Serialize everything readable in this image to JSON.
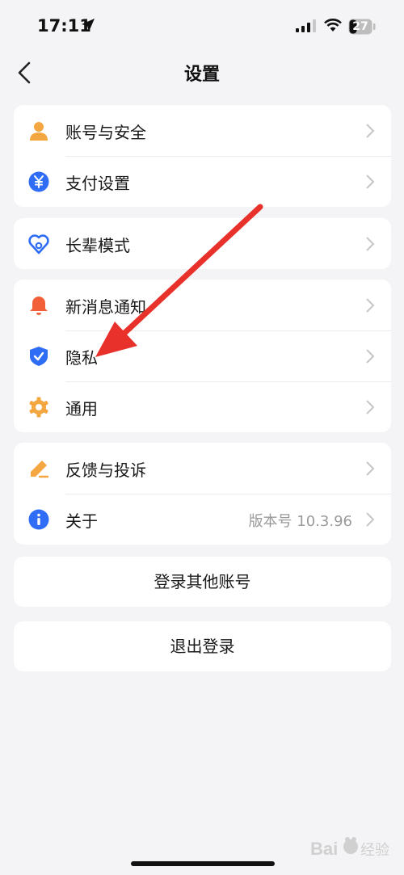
{
  "status_bar": {
    "time": "17:11",
    "battery": "27"
  },
  "nav": {
    "title": "设置"
  },
  "groups": [
    {
      "items": [
        {
          "label": "账号与安全",
          "icon": "user-icon"
        },
        {
          "label": "支付设置",
          "icon": "yuan-icon"
        }
      ]
    },
    {
      "items": [
        {
          "label": "长辈模式",
          "icon": "elder-heart-icon"
        }
      ]
    },
    {
      "items": [
        {
          "label": "新消息通知",
          "icon": "bell-icon"
        },
        {
          "label": "隐私",
          "icon": "shield-icon"
        },
        {
          "label": "通用",
          "icon": "gear-icon"
        }
      ]
    },
    {
      "items": [
        {
          "label": "反馈与投诉",
          "icon": "pencil-icon"
        },
        {
          "label": "关于",
          "icon": "info-icon",
          "value": "版本号 10.3.96"
        }
      ]
    }
  ],
  "actions": {
    "login_other": "登录其他账号",
    "logout": "退出登录"
  },
  "watermark": "Baidu 经验",
  "colors": {
    "accent_blue": "#2f6df6",
    "orange": "#f4a640",
    "red": "#f2603a",
    "arrow": "#e8312b"
  }
}
